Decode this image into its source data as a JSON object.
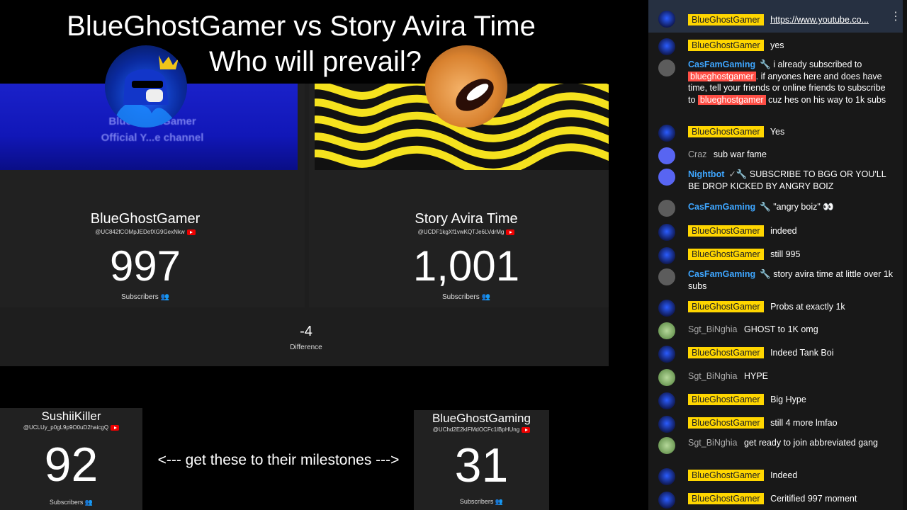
{
  "title": {
    "line1": "BlueGhostGamer vs Story Avira Time",
    "line2": "Who will prevail?"
  },
  "battle": {
    "left": {
      "name": "BlueGhostGamer",
      "id": "@UC842fCOMpJEDefXG9GexNkw",
      "count": "997",
      "subs_label": "Subscribers",
      "banner_text_1": "BlueGhostGamer",
      "banner_text_2": "Official Y...e channel"
    },
    "right": {
      "name": "Story Avira Time",
      "id": "@UCDF1kgXf1vwKQTJe6LVdrMg",
      "count": "1,001",
      "subs_label": "Subscribers"
    },
    "difference": "-4",
    "difference_label": "Difference"
  },
  "small_cards": {
    "a": {
      "name": "SushiiKiller",
      "id": "@UCLUy_p0gL9p9O0uD2haicgQ",
      "count": "92",
      "subs_label": "Subscribers"
    },
    "b": {
      "name": "BlueGhostGaming",
      "id": "@UChd2E2kIFMdOCFc1lBpHUng",
      "count": "31",
      "subs_label": "Subscribers"
    }
  },
  "milestone_text": "<--- get these to their milestones --->",
  "chat": {
    "messages": [
      {
        "author": "BlueGhostGamer",
        "type": "owner",
        "text": "https://www.youtube.co...",
        "link": true,
        "avatar": "blue"
      },
      {
        "author": "BlueGhostGamer",
        "type": "owner",
        "text": "yes",
        "avatar": "blue"
      },
      {
        "author": "CasFamGaming",
        "type": "mod",
        "pre": "i already subscribed to",
        "hl1": "blueghostgamer",
        "mid": ". if anyones here and does have time, tell your friends or online friends to subscribe to",
        "hl2": "blueghostgamer",
        "post": "cuz hes on his way to 1k subs",
        "avatar": "gray"
      },
      {
        "author": "BlueGhostGamer",
        "type": "owner",
        "text": "Yes",
        "avatar": "blue"
      },
      {
        "author": "Craz",
        "type": "plain",
        "text": "sub war fame",
        "avatar": "discord"
      },
      {
        "author": "Nightbot",
        "type": "mod",
        "text": "SUBSCRIBE TO BGG OR YOU'LL BE DROP KICKED BY ANGRY BOIZ",
        "avatar": "discord"
      },
      {
        "author": "CasFamGaming",
        "type": "mod",
        "text": "\"angry boiz\" 👀",
        "avatar": "gray"
      },
      {
        "author": "BlueGhostGamer",
        "type": "owner",
        "text": "indeed",
        "avatar": "blue"
      },
      {
        "author": "BlueGhostGamer",
        "type": "owner",
        "text": "still 995",
        "avatar": "blue"
      },
      {
        "author": "CasFamGaming",
        "type": "mod",
        "text": "story avira time at little over 1k subs",
        "avatar": "gray"
      },
      {
        "author": "BlueGhostGamer",
        "type": "owner",
        "text": "Probs at exactly 1k",
        "avatar": "blue"
      },
      {
        "author": "Sgt_BiNghia",
        "type": "plain",
        "text": "GHOST to 1K omg",
        "avatar": "green"
      },
      {
        "author": "BlueGhostGamer",
        "type": "owner",
        "text": "Indeed Tank Boi",
        "avatar": "blue"
      },
      {
        "author": "Sgt_BiNghia",
        "type": "plain",
        "text": "HYPE",
        "avatar": "green"
      },
      {
        "author": "BlueGhostGamer",
        "type": "owner",
        "text": "Big Hype",
        "avatar": "blue"
      },
      {
        "author": "BlueGhostGamer",
        "type": "owner",
        "text": "still 4 more lmfao",
        "avatar": "blue"
      },
      {
        "author": "Sgt_BiNghia",
        "type": "plain",
        "text": "get ready to join abbreviated gang",
        "avatar": "green"
      },
      {
        "author": "BlueGhostGamer",
        "type": "owner",
        "text": "Indeed",
        "avatar": "blue"
      },
      {
        "author": "BlueGhostGamer",
        "type": "owner",
        "text": "Ceritified 997 moment",
        "avatar": "blue"
      }
    ]
  }
}
